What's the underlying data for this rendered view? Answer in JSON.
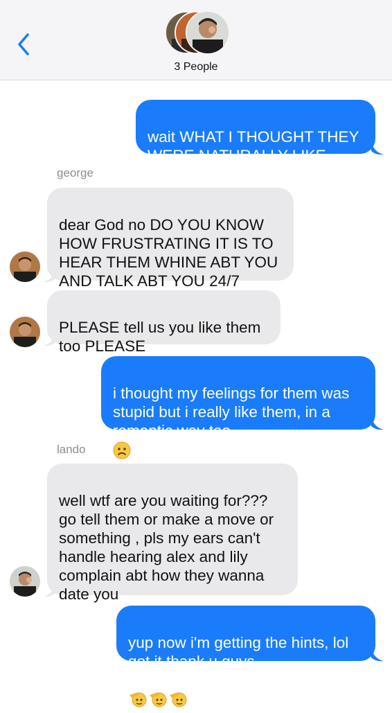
{
  "header": {
    "participants_label": "3 People"
  },
  "messages": [
    {
      "type": "sent",
      "text": "wait WHAT I THOUGHT THEY\nWERE NATURALLY LIKE THAT"
    },
    {
      "type": "received",
      "sender": "george",
      "text": "dear God no DO YOU KNOW\nHOW FRUSTRATING IT IS TO\nHEAR THEM WHINE ABT YOU\nAND TALK ABT YOU 24/7"
    },
    {
      "type": "received",
      "text": "PLEASE tell us you like them\ntoo PLEASE"
    },
    {
      "type": "sent",
      "text": "i thought my feelings for them was\nstupid but i really like them, in a\nromantic way too",
      "emoji": "frowning-face"
    },
    {
      "type": "received",
      "sender": "lando",
      "text": "well wtf are you waiting for???\ngo tell them or make a move or\nsomething , pls my ears can't\nhandle hearing alex and lily\ncomplain abt how they wanna\ndate you"
    },
    {
      "type": "sent",
      "text": "yup now i'm getting the hints, lol\ngot it thank u guys",
      "emoji": "saluting-face x3"
    }
  ],
  "colors": {
    "sent_bubble": "#1a7cfa",
    "received_bubble": "#e9e9eb",
    "header_bg": "#f5f5f7",
    "accent": "#1a7cfa"
  }
}
